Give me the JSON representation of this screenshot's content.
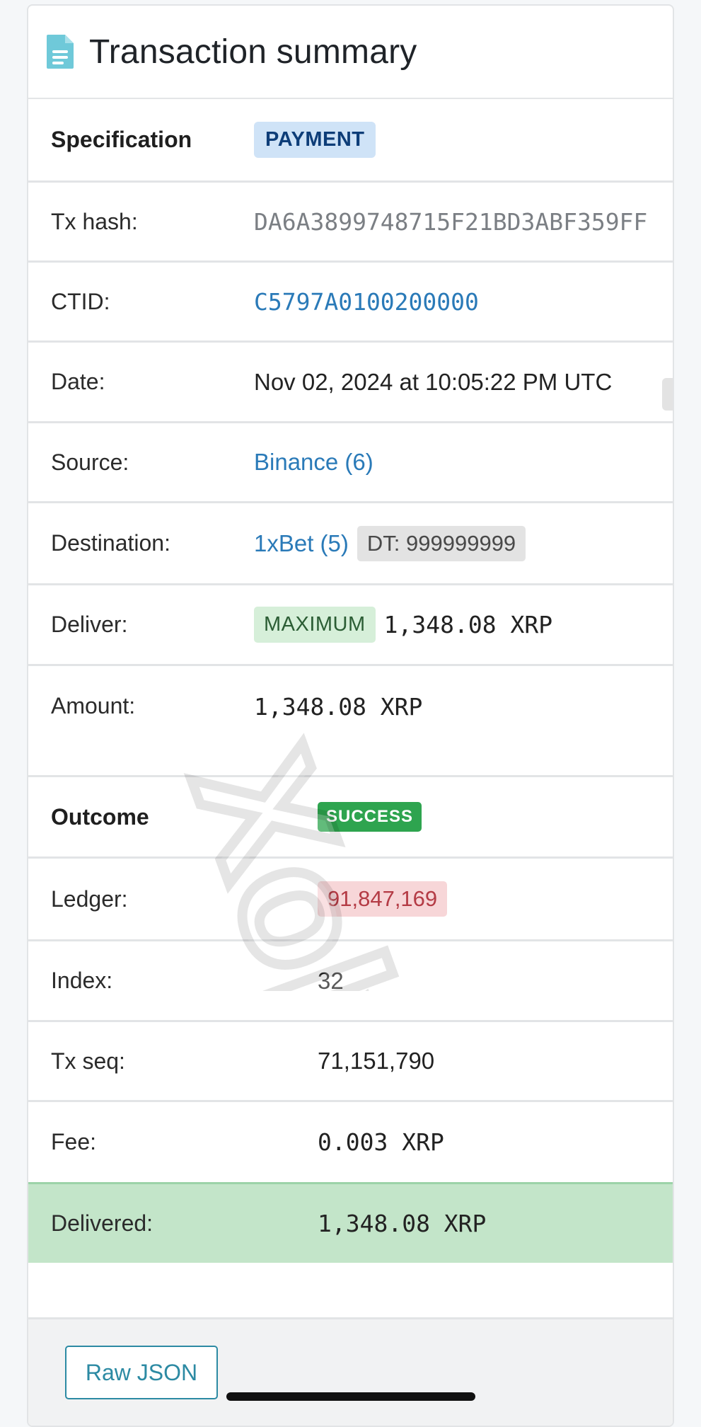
{
  "header": {
    "title": "Transaction summary",
    "icon": "document-icon"
  },
  "specification": {
    "label": "Specification",
    "type": "PAYMENT"
  },
  "details": {
    "tx_hash_label": "Tx hash:",
    "tx_hash": "DA6A3899748715F21BD3ABF359FF",
    "ctid_label": "CTID:",
    "ctid": "C5797A0100200000",
    "date_label": "Date:",
    "date": "Nov 02, 2024 at 10:05:22 PM UTC",
    "source_label": "Source:",
    "source": "Binance (6)",
    "destination_label": "Destination:",
    "destination": "1xBet (5)",
    "destination_tag": "DT: 999999999",
    "deliver_label": "Deliver:",
    "deliver_badge": "MAXIMUM",
    "deliver_value": "1,348.08 XRP",
    "amount_label": "Amount:",
    "amount": "1,348.08 XRP"
  },
  "outcome": {
    "label": "Outcome",
    "status": "SUCCESS",
    "ledger_label": "Ledger:",
    "ledger": "91,847,169",
    "index_label": "Index:",
    "index": "32",
    "tx_seq_label": "Tx seq:",
    "tx_seq": "71,151,790",
    "fee_label": "Fee:",
    "fee": "0.003 XRP",
    "delivered_label": "Delivered:",
    "delivered": "1,348.08 XRP"
  },
  "footer": {
    "raw_json_label": "Raw JSON"
  },
  "watermark": {
    "text": "Xolvie"
  },
  "colors": {
    "link": "#2a7ab8",
    "success": "#2ea44f",
    "delivered_bg": "#c3e5c9",
    "payment_badge_bg": "#cfe3f7",
    "ledger_badge_bg": "#f7d6d8"
  }
}
